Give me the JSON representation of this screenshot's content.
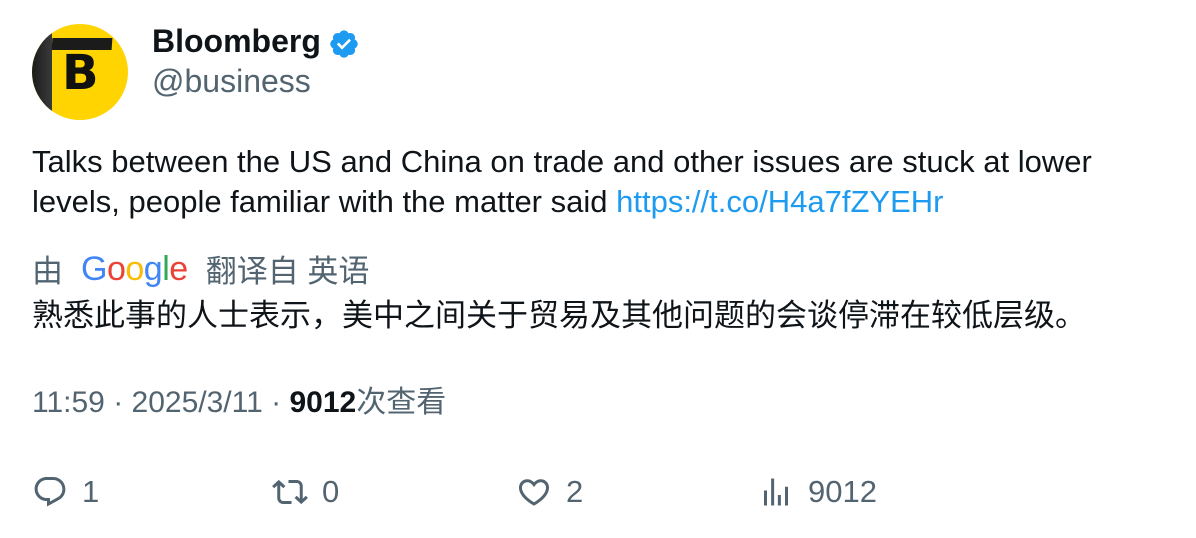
{
  "author": {
    "display_name": "Bloomberg",
    "handle": "@business",
    "avatar_letter": "B",
    "verified": true,
    "verified_color": "#1d9bf0"
  },
  "tweet": {
    "text": "Talks between the US and China on trade and other issues are stuck at lower levels, people familiar with the matter said ",
    "link": "https://t.co/H4a7fZYEHr",
    "link_color": "#1d9bf0"
  },
  "translation": {
    "prefix": "由",
    "provider": "Google",
    "suffix": "翻译自 英语",
    "text": "熟悉此事的人士表示，美中之间关于贸易及其他问题的会谈停滞在较低层级。"
  },
  "meta": {
    "time": "11:59",
    "separator": "·",
    "date": "2025/3/11",
    "views_count": "9012",
    "views_label": "次查看"
  },
  "actions": {
    "reply_count": "1",
    "retweet_count": "0",
    "like_count": "2",
    "views_count": "9012"
  },
  "colors": {
    "text_primary": "#0f1419",
    "text_secondary": "#536471",
    "avatar_bg": "#ffd400"
  },
  "icons": [
    "reply-icon",
    "retweet-icon",
    "like-icon",
    "views-icon",
    "verified-badge-icon"
  ]
}
